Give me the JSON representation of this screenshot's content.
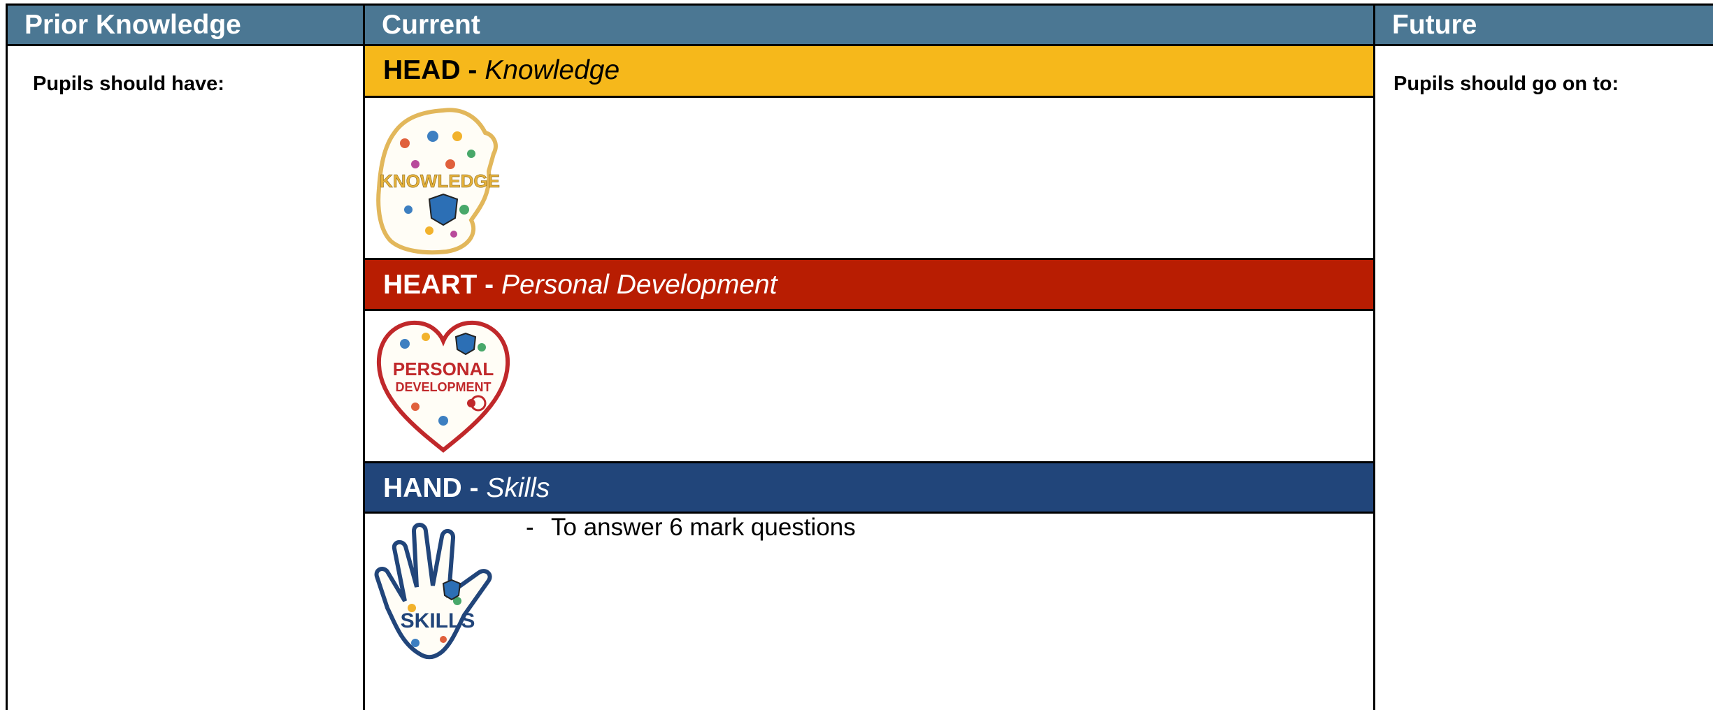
{
  "columns": {
    "prior": {
      "header": "Prior Knowledge",
      "intro": "Pupils should have:"
    },
    "current": {
      "header": "Current"
    },
    "future": {
      "header": "Future",
      "intro": "Pupils should go on to:"
    }
  },
  "sections": {
    "head": {
      "label": "HEAD -",
      "subtitle": "Knowledge",
      "image_text": "KNOWLEDGE",
      "color": "#f6b81b"
    },
    "heart": {
      "label": "HEART -",
      "subtitle": "Personal Development",
      "image_text_1": "PERSONAL",
      "image_text_2": "DEVELOPMENT",
      "color": "#b81d02"
    },
    "hand": {
      "label": "HAND -",
      "subtitle": "Skills",
      "image_text": "SKILLS",
      "color": "#21457a",
      "bullets": [
        "To answer 6 mark questions"
      ]
    }
  },
  "header_color": "#4b7793"
}
